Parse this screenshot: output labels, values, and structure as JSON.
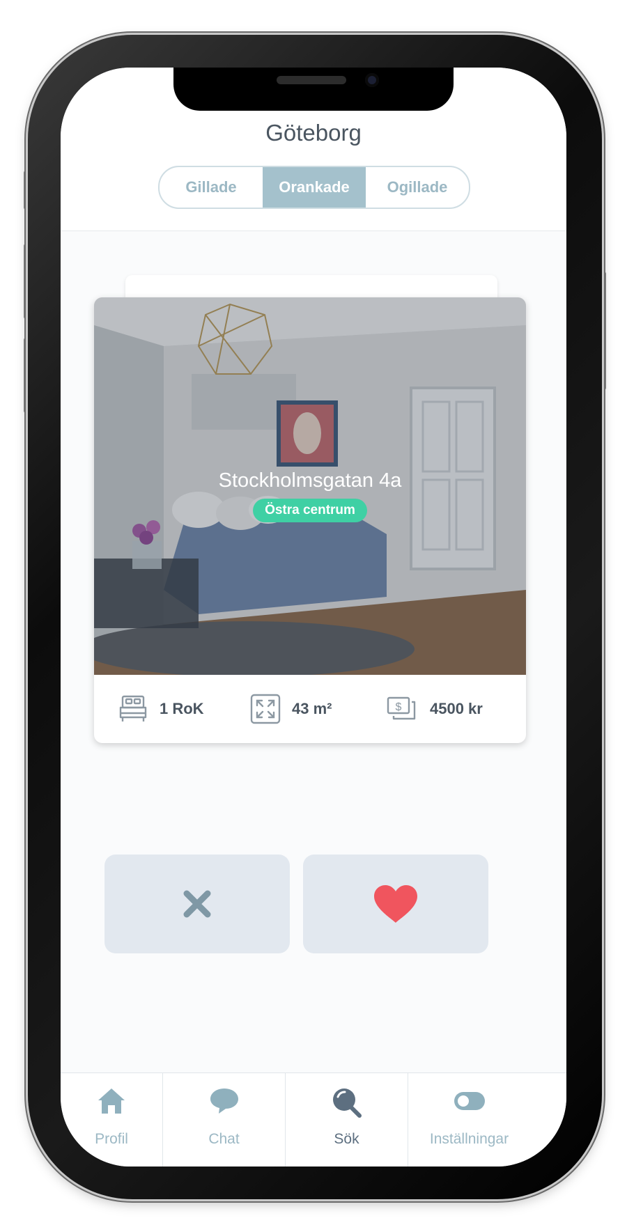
{
  "header": {
    "title": "Göteborg",
    "segments": [
      "Gillade",
      "Orankade",
      "Ogillade"
    ],
    "active_segment": "Orankade"
  },
  "listing": {
    "street": "Stockholmsgatan  4a",
    "area": "Östra centrum",
    "rooms": "1 RoK",
    "size": "43 m²",
    "rent": "4500 kr"
  },
  "actions": {
    "dislike_icon": "close-icon",
    "like_icon": "heart-icon",
    "like_color": "#f0555e",
    "dislike_color": "#7f98a5"
  },
  "tabbar": {
    "items": [
      {
        "label": "Profil",
        "icon": "home-icon"
      },
      {
        "label": "Chat",
        "icon": "chat-bubble-icon"
      },
      {
        "label": "Sök",
        "icon": "search-icon"
      },
      {
        "label": "Inställningar",
        "icon": "toggle-icon"
      }
    ],
    "active": "Sök"
  },
  "colors": {
    "accent": "#a4c1cc",
    "badge": "#3fd0a4",
    "text": "#4a5560"
  }
}
